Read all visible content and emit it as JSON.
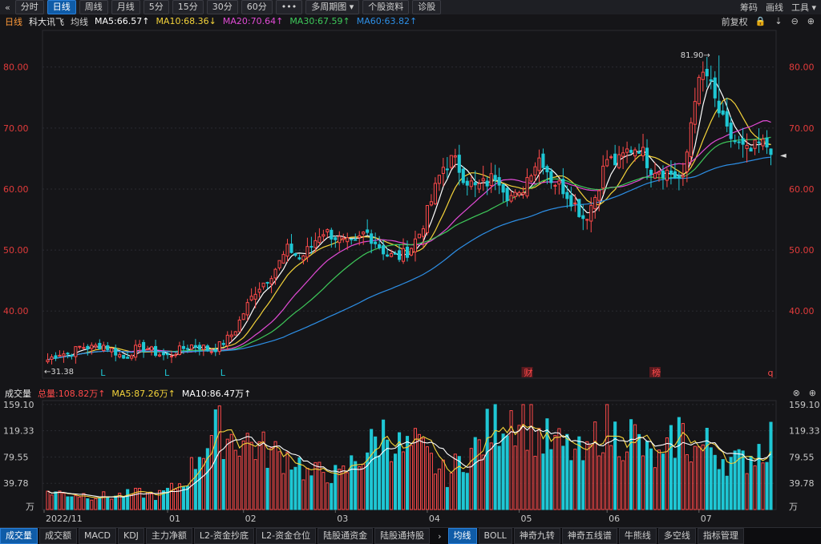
{
  "toolbar": {
    "back_icon": "«",
    "items": [
      "分时",
      "日线",
      "周线",
      "月线",
      "5分",
      "15分",
      "30分",
      "60分",
      "•••",
      "多周期图 ▾",
      "个股资料",
      "诊股"
    ],
    "active_index": 1,
    "right": [
      "筹码",
      "画线",
      "工具 ▾"
    ]
  },
  "main_legend": {
    "period": "日线",
    "stock_name": "科大讯飞",
    "mode": "均线",
    "ma5": "MA5:66.57↑",
    "ma10": "MA10:68.36↓",
    "ma20": "MA20:70.64↑",
    "ma30": "MA30:67.59↑",
    "ma60": "MA60:63.82↑",
    "adjust": "前复权",
    "controls": [
      "🔒",
      "⇣",
      "⊖",
      "⊕"
    ]
  },
  "vol_legend": {
    "title": "成交量",
    "total": "总量:108.82万↑",
    "ma5": "MA5:87.26万↑",
    "ma10": "MA10:86.47万↑",
    "controls": [
      "⊗",
      "⊕"
    ]
  },
  "tabs": {
    "left": [
      "成交量",
      "成交额",
      "MACD",
      "KDJ",
      "主力净额",
      "L2-资金抄底",
      "L2-资金仓位",
      "陆股通资金",
      "陆股通持股"
    ],
    "left_active": 0,
    "arrow": "›",
    "right": [
      "均线",
      "BOLL",
      "神奇九转",
      "神奇五线谱",
      "牛熊线",
      "多空线",
      "指标管理"
    ],
    "right_active": 0
  },
  "colors": {
    "up": "#ff4a4a",
    "down": "#1fc7d4",
    "ma5": "#ffffff",
    "ma10": "#f4d33a",
    "ma20": "#e24bd6",
    "ma30": "#3ec95a",
    "ma60": "#2d8fe6",
    "axis_text": "#e23b3b",
    "grid": "#2a2b31"
  },
  "chart_data": [
    {
      "type": "candlestick",
      "title": "",
      "price_axis": {
        "ticks": [
          "80.00",
          "70.00",
          "60.00",
          "50.00",
          "40.00"
        ],
        "ylim": [
          29,
          86
        ]
      },
      "annotations": {
        "high": "81.90→",
        "low": "←31.38",
        "current_marker": "◄"
      },
      "markers": [
        {
          "label": "L",
          "date_index": 14
        },
        {
          "label": "L",
          "date_index": 30
        },
        {
          "label": "L",
          "date_index": 44
        },
        {
          "label": "财",
          "date_index": 120
        },
        {
          "label": "榜",
          "date_index": 152
        },
        {
          "label": "q",
          "date_index": 181
        }
      ],
      "series": [
        {
          "name": "MA5",
          "value": "66.57"
        },
        {
          "name": "MA10",
          "value": "68.36"
        },
        {
          "name": "MA20",
          "value": "70.64"
        },
        {
          "name": "MA30",
          "value": "67.59"
        },
        {
          "name": "MA60",
          "value": "63.82"
        }
      ],
      "anchor_closes": [
        32.0,
        33.1,
        33.0,
        34.2,
        34.0,
        34.5,
        33.5,
        32.2,
        33.8,
        34.0,
        33.0,
        32.6,
        33.6,
        34.4,
        34.2,
        33.5,
        34.8,
        36.5,
        40.2,
        43.5,
        45.2,
        47.5,
        50.4,
        48.5,
        50.5,
        53.2,
        52.5,
        51.2,
        50.8,
        53.1,
        51.2,
        49.2,
        48.8,
        50.0,
        53.0,
        58.0,
        63.5,
        65.0,
        62.0,
        60.2,
        61.0,
        62.5,
        59.0,
        58.5,
        63.0,
        65.5,
        61.5,
        60.2,
        57.8,
        55.0,
        59.0,
        65.0,
        64.2,
        66.5,
        67.0,
        63.5,
        63.2,
        62.5,
        61.2,
        75.2,
        79.5,
        73.8,
        69.2,
        67.2,
        65.8,
        67.5,
        66.8
      ]
    },
    {
      "type": "bar",
      "title": "",
      "volume_axis": {
        "ticks": [
          "159.10",
          "119.33",
          "79.55",
          "39.78"
        ],
        "unit": "万",
        "ylim": [
          0,
          165
        ]
      },
      "x_labels": [
        "2022/11",
        "01",
        "02",
        "03",
        "04",
        "05",
        "06",
        "07"
      ],
      "vol_anchors": [
        28,
        24,
        23,
        21,
        20,
        22,
        25,
        20,
        30,
        45,
        95,
        120,
        110,
        104,
        90,
        82,
        80,
        50,
        60,
        48,
        75,
        95,
        120,
        88,
        95,
        70,
        50,
        80,
        95,
        130,
        150,
        140,
        108,
        97,
        90,
        75,
        130,
        110,
        115,
        80,
        72,
        120,
        90,
        98,
        78,
        70,
        88,
        108
      ]
    }
  ]
}
